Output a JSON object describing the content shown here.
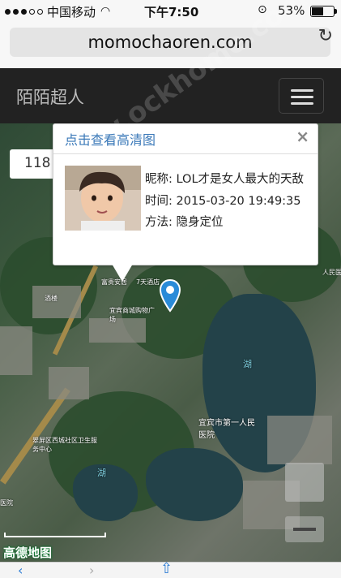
{
  "status_bar": {
    "carrier": "中国移动",
    "time": "下午7:50",
    "battery_percent": "53%",
    "battery_level": 0.53
  },
  "browser": {
    "url": "momochaoren.com",
    "reload_icon": "reload-icon"
  },
  "app": {
    "title": "陌陌超人",
    "menu_icon": "hamburger-menu-icon"
  },
  "map": {
    "search_text": "118",
    "logo": "高德地图",
    "labels": {
      "road1": "富贵安居",
      "road2": "酒楼",
      "lake_top": "湖",
      "hospital": "宜宾市第一人民医院",
      "lake_bottom": "湖",
      "community": "翠屏区西城社区卫生服务中心",
      "hospital_left": "医院",
      "hotel": "7天酒店",
      "shop": "宜宾商城购物广场",
      "people_hospital": "人民医"
    }
  },
  "popup": {
    "title": "点击查看高清图",
    "close_icon": "close-icon",
    "nickname_label": "昵称:",
    "nickname_value": "LOL才是女人最大的天敌",
    "time_label": "时间:",
    "time_value": "2015-03-20 19:49:35",
    "method_label": "方法:",
    "method_value": "隐身定位"
  },
  "watermark": "www.ockhome.com"
}
